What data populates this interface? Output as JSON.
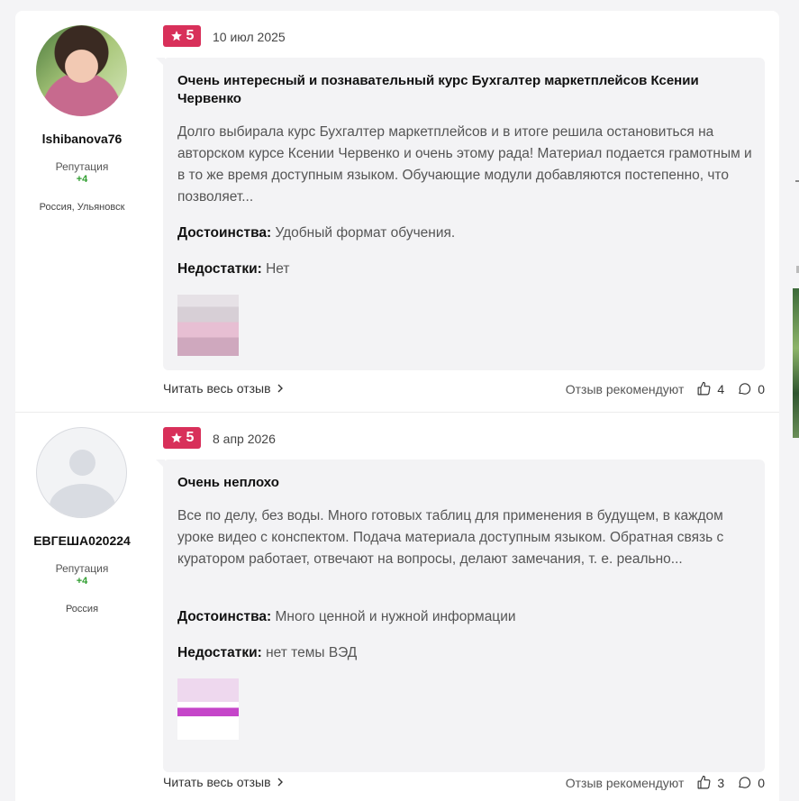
{
  "reviews": [
    {
      "username": "lshibanova76",
      "reputation_label": "Репутация",
      "reputation_value": "+4",
      "location": "Россия, Ульяновск",
      "rating": "5",
      "date": "10 июл 2025",
      "title": "Очень интересный и познавательный курс Бухгалтер маркетплейсов Ксении Червенко",
      "text": "Долго выбирала курс Бухгалтер маркетплейсов и в итоге решила остановиться на авторском курсе Ксении Червенко и очень этому рада! Материал подается грамотным и в то же время доступным языком. Обучающие модули добавляются постепенно, что позволяет...",
      "pros_label": "Достоинства:",
      "pros": "Удобный формат обучения.",
      "cons_label": "Недостатки:",
      "cons": "Нет",
      "read_more": "Читать весь отзыв",
      "recommend_label": "Отзыв рекомендуют",
      "likes": "4",
      "comments": "0"
    },
    {
      "username": "ЕВГЕША020224",
      "reputation_label": "Репутация",
      "reputation_value": "+4",
      "location": "Россия",
      "rating": "5",
      "date": "8 апр 2026",
      "title": "Очень неплохо",
      "text": "Все по делу, без воды. Много готовых таблиц для применения в будущем, в каждом уроке видео с конспектом. Подача материала доступным языком. Обратная связь с куратором работает, отвечают на вопросы, делают замечания, т. е. реально...",
      "pros_label": "Достоинства:",
      "pros": "Много ценной и нужной информации",
      "cons_label": "Недостатки:",
      "cons": "нет темы ВЭД",
      "read_more": "Читать весь отзыв",
      "recommend_label": "Отзыв рекомендуют",
      "likes": "3",
      "comments": "0"
    }
  ],
  "colors": {
    "rating_badge": "#d8305a",
    "reputation_positive": "#2e9d2e",
    "content_bg": "#f3f3f5"
  },
  "icons": [
    "star-icon",
    "chevron-right-icon",
    "thumbs-up-icon",
    "comment-icon"
  ]
}
